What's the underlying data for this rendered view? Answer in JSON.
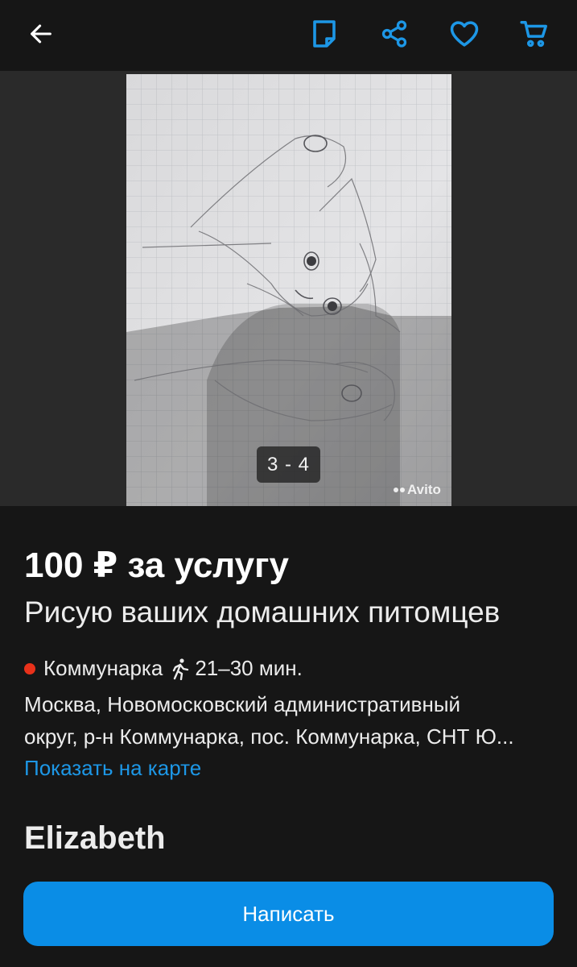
{
  "topbar": {
    "icons": [
      "arrow-left-icon",
      "note-icon",
      "share-icon",
      "heart-icon",
      "cart-icon"
    ],
    "accent_color": "#1d97e6"
  },
  "gallery": {
    "counter": "3 - 4",
    "watermark": "Avito"
  },
  "listing": {
    "price": "100 ₽ за услугу",
    "title": "Рисую ваших домашних питомцев",
    "metro_station": "Коммунарка",
    "travel_time": "21–30 мин.",
    "address_line1": "Москва, Новомосковский административный",
    "address_line2": "округ, р-н Коммунарка, пос. Коммунарка, СНТ Ю...",
    "map_link": "Показать на карте",
    "metro_color": "#e8311a"
  },
  "seller": {
    "name": "Elizabeth"
  },
  "actions": {
    "write_label": "Написать",
    "button_color": "#0a8de6"
  }
}
